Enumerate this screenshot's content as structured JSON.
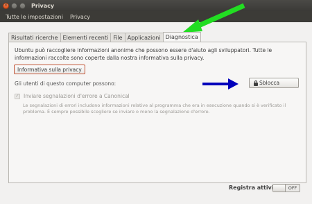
{
  "window": {
    "title": "Privacy",
    "close_glyph": "×"
  },
  "toolbar": {
    "all_settings": "Tutte le impostazioni",
    "current": "Privacy"
  },
  "tabs": [
    {
      "label": "Risultati ricerche"
    },
    {
      "label": "Elementi recenti"
    },
    {
      "label": "File"
    },
    {
      "label": "Applicazioni"
    },
    {
      "label": "Diagnostica",
      "active": true
    }
  ],
  "diagnostics": {
    "description": "Ubuntu può raccogliere informazioni anonime che possono essere d'aiuto agli sviluppatori. Tutte le informazioni raccolte sono coperte dalla nostra informativa sulla privacy.",
    "privacy_button": "Informativa sulla privacy",
    "users_label": "Gli utenti di questo computer possono:",
    "unlock_button": "Sblocca",
    "error_reports_label": "Inviare segnalazioni d'errore a Canonical",
    "error_reports_checked": true,
    "error_reports_desc": "Le segnalazioni di errori includono informazioni relative al programma che era in esecuzione quando si è verificato il problema. È sempre possibile scegliere se inviare o meno la segnalazione d'errore."
  },
  "footer": {
    "record_activity_label": "Registra attività",
    "toggle_state": "OFF"
  },
  "annotations": {
    "green_arrow_color": "#22dd22",
    "blue_arrow_color": "#0000bb"
  },
  "icons": [
    "close-icon",
    "minimize-icon",
    "maximize-icon",
    "lock-icon",
    "checkmark-icon"
  ]
}
